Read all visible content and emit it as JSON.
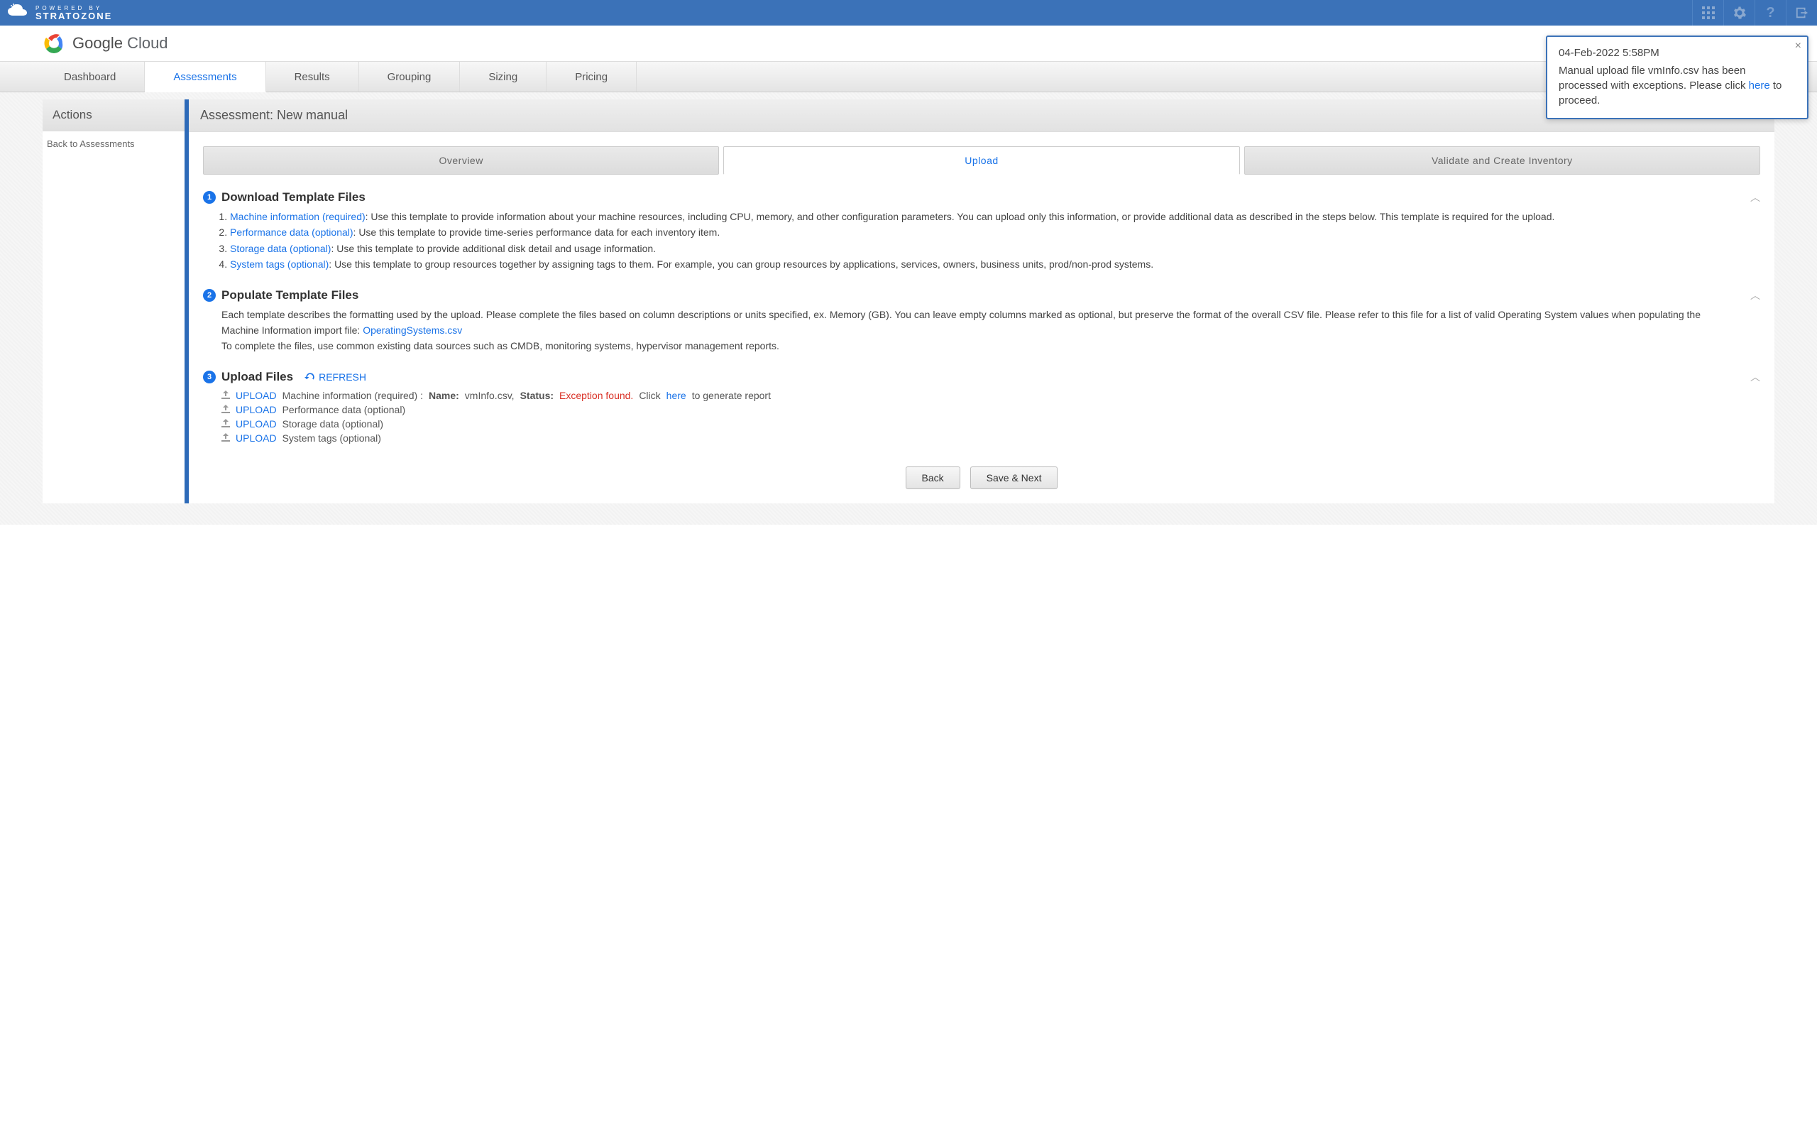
{
  "topbar": {
    "powered": "POWERED BY",
    "brand": "STRATOZONE"
  },
  "gc_header": {
    "strong": "Google",
    "light": " Cloud"
  },
  "nav": {
    "items": [
      "Dashboard",
      "Assessments",
      "Results",
      "Grouping",
      "Sizing",
      "Pricing"
    ],
    "active_index": 1
  },
  "sidebar": {
    "header": "Actions",
    "back": "Back to Assessments"
  },
  "main": {
    "title": "Assessment: New manual",
    "subtabs": [
      "Overview",
      "Upload",
      "Validate and Create Inventory"
    ],
    "subtab_active_index": 1
  },
  "step1": {
    "title": "Download Template Files",
    "items": [
      {
        "link": "Machine information (required)",
        "desc": ": Use this template to provide information about your machine resources, including CPU, memory, and other configuration parameters. You can upload only this information, or provide additional data as described in the steps below. This template is required for the upload."
      },
      {
        "link": "Performance data (optional)",
        "desc": ": Use this template to provide time-series performance data for each inventory item."
      },
      {
        "link": "Storage data (optional)",
        "desc": ": Use this template to provide additional disk detail and usage information."
      },
      {
        "link": "System tags (optional)",
        "desc": ": Use this template to group resources together by assigning tags to them. For example, you can group resources by applications, services, owners, business units, prod/non-prod systems."
      }
    ]
  },
  "step2": {
    "title": "Populate Template Files",
    "desc1": "Each template describes the formatting used by the upload. Please complete the files based on column descriptions or units specified, ex. Memory (GB). You can leave empty columns marked as optional, but preserve the format of the overall CSV file. Please refer to this file for a list of valid Operating System values when populating the Machine Information import file: ",
    "os_link": "OperatingSystems.csv",
    "desc2": "To complete the files, use common existing data sources such as CMDB, monitoring systems, hypervisor management reports."
  },
  "step3": {
    "title": "Upload Files",
    "refresh": "REFRESH",
    "rows": [
      {
        "label": "Machine information (required) : ",
        "name_label": "Name:",
        "name_value": "vmInfo.csv,",
        "status_label": "Status:",
        "status_value": "Exception found.",
        "click_text": "Click ",
        "here": "here",
        "gen": " to generate report"
      },
      {
        "label": "Performance data (optional)"
      },
      {
        "label": "Storage data (optional)"
      },
      {
        "label": "System tags (optional)"
      }
    ],
    "upload": "UPLOAD"
  },
  "buttons": {
    "back": "Back",
    "next": "Save & Next"
  },
  "notify": {
    "time": "04-Feb-2022 5:58PM",
    "body1": "Manual upload file vmInfo.csv has been processed with exceptions. Please click ",
    "here": "here",
    "body2": " to proceed."
  }
}
